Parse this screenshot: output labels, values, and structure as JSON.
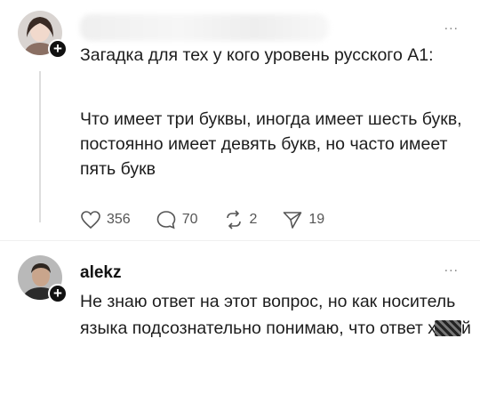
{
  "post": {
    "more_label": "...",
    "text_line1": "Загадка для тех у кого уровень русского А1:",
    "text_line2": "Что имеет три буквы, иногда имеет шесть букв, постоянно имеет девять букв, но часто имеет пять букв",
    "likes": "356",
    "replies": "70",
    "reposts": "2",
    "shares": "19"
  },
  "reply": {
    "username": "alekz",
    "more_label": "...",
    "text": "Не знаю ответ на этот вопрос, но как носитель языка подсознательно понимаю, что ответ х",
    "text_tail": "й"
  },
  "icons": [
    "heart-icon",
    "comment-icon",
    "repost-icon",
    "share-icon",
    "plus-icon",
    "more-icon"
  ],
  "colors": {
    "text": "#1d1d1d",
    "muted": "#555555",
    "badge": "#111111",
    "line": "#dddddd"
  }
}
